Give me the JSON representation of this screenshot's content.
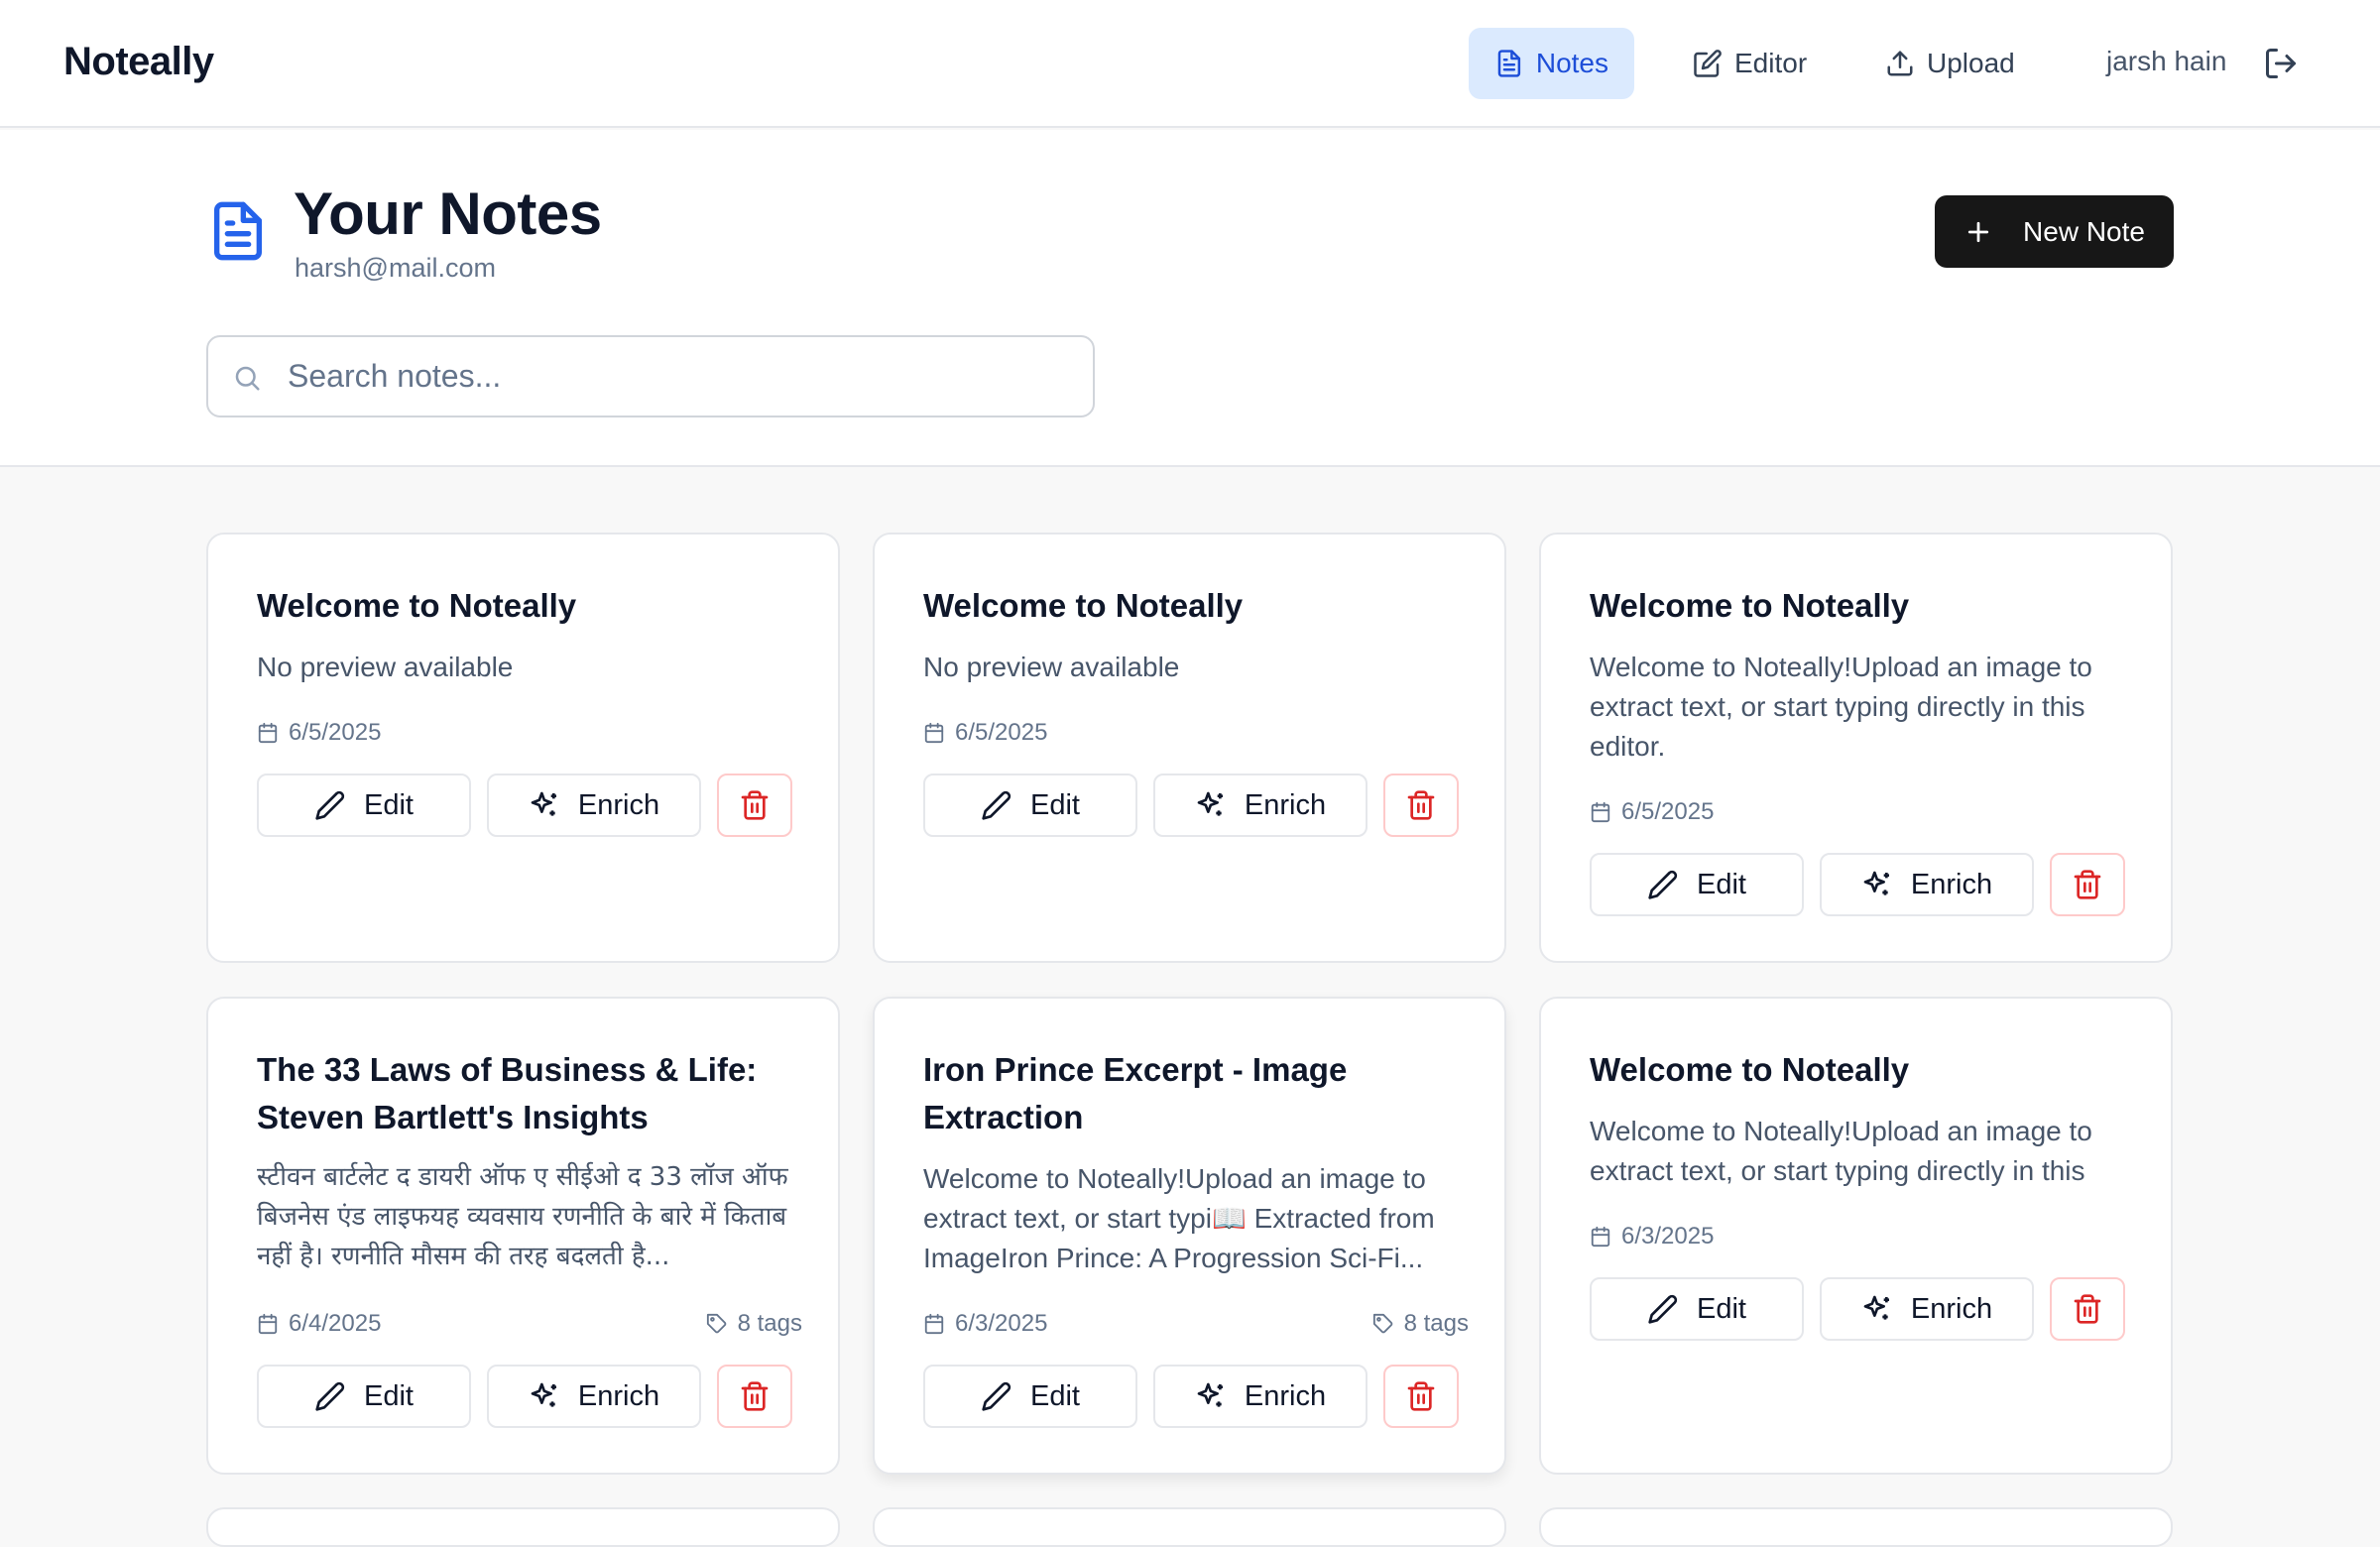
{
  "app": {
    "name": "Noteally"
  },
  "nav": {
    "items": [
      {
        "label": "Notes",
        "icon": "file-text-icon",
        "active": true
      },
      {
        "label": "Editor",
        "icon": "pencil-square-icon",
        "active": false
      },
      {
        "label": "Upload",
        "icon": "upload-icon",
        "active": false
      }
    ],
    "user": "jarsh hain",
    "logout_icon": "logout-icon"
  },
  "header": {
    "title": "Your Notes",
    "email": "harsh@mail.com",
    "new_note_label": "New Note"
  },
  "search": {
    "placeholder": "Search notes...",
    "value": ""
  },
  "actions": {
    "edit": "Edit",
    "enrich": "Enrich"
  },
  "colors": {
    "accent": "#2563eb",
    "active_nav_bg": "#dbeafe",
    "primary_button": "#171717",
    "danger": "#dc2626"
  },
  "notes": [
    {
      "title": "Welcome to Noteally",
      "preview": "No preview available",
      "date": "6/5/2025",
      "tags": ""
    },
    {
      "title": "Welcome to Noteally",
      "preview": "No preview available",
      "date": "6/5/2025",
      "tags": ""
    },
    {
      "title": "Welcome to Noteally",
      "preview": "Welcome to Noteally!Upload an image to extract text, or start typing directly in this editor.",
      "date": "6/5/2025",
      "tags": ""
    },
    {
      "title": "The 33 Laws of Business & Life: Steven Bartlett's Insights",
      "preview": "स्टीवन बार्टलेट द डायरी ऑफ ए सीईओ द 33 लॉज ऑफ बिजनेस एंड लाइफयह व्यवसाय रणनीति के बारे में किताब नहीं है। रणनीति मौसम की तरह बदलती है...",
      "date": "6/4/2025",
      "tags": "8 tags"
    },
    {
      "title": "Iron Prince Excerpt - Image Extraction",
      "preview": "Welcome to Noteally!Upload an image to extract text, or start typi📖 Extracted from ImageIron Prince: A Progression Sci-Fi...",
      "date": "6/3/2025",
      "tags": "8 tags"
    },
    {
      "title": "Welcome to Noteally",
      "preview": "Welcome to Noteally!Upload an image to extract text, or start typing directly in this",
      "date": "6/3/2025",
      "tags": ""
    }
  ]
}
